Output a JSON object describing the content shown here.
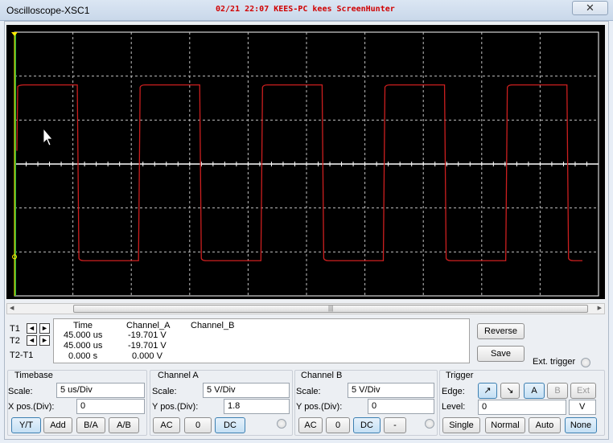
{
  "window": {
    "title": "Oscilloscope-XSC1",
    "banner": "02/21 22:07 KEES-PC kees ScreenHunter",
    "close_glyph": "✕"
  },
  "colors": {
    "screen_bg": "#000000",
    "trace_a": "#cc1f1f",
    "grid": "#bfbfbf",
    "cursor_t1": "#ffeb00",
    "cursor_t2": "#2fb43a"
  },
  "waveform": {
    "type": "square",
    "channel": "A",
    "high_divs": 1.8,
    "low_divs": -2.2,
    "cycles_visible": 4.9
  },
  "cursors": {
    "t1_label": "T1",
    "t2_label": "T2",
    "diff_label": "T2-T1",
    "left_arrow": "◄",
    "right_arrow": "►"
  },
  "readout": {
    "headers": {
      "time": "Time",
      "channel_a": "Channel_A",
      "channel_b": "Channel_B"
    },
    "rows": [
      {
        "time": "45.000 us",
        "channel_a": "-19.701 V",
        "channel_b": ""
      },
      {
        "time": "45.000 us",
        "channel_a": "-19.701 V",
        "channel_b": ""
      },
      {
        "time": "0.000 s",
        "channel_a": "0.000 V",
        "channel_b": ""
      }
    ]
  },
  "actions": {
    "reverse": "Reverse",
    "save": "Save",
    "ext_trigger": "Ext. trigger"
  },
  "timebase": {
    "title": "Timebase",
    "scale_label": "Scale:",
    "scale_value": "5 us/Div",
    "xpos_label": "X pos.(Div):",
    "xpos_value": "0",
    "modes": [
      "Y/T",
      "Add",
      "B/A",
      "A/B"
    ],
    "selected_mode": "Y/T"
  },
  "channel_a": {
    "title": "Channel A",
    "scale_label": "Scale:",
    "scale_value": "5  V/Div",
    "ypos_label": "Y pos.(Div):",
    "ypos_value": "1.8",
    "coupling": [
      "AC",
      "0",
      "DC"
    ],
    "selected_coupling": "DC"
  },
  "channel_b": {
    "title": "Channel B",
    "scale_label": "Scale:",
    "scale_value": "5  V/Div",
    "ypos_label": "Y pos.(Div):",
    "ypos_value": "0",
    "coupling": [
      "AC",
      "0",
      "DC",
      "-"
    ],
    "selected_coupling": "DC"
  },
  "trigger": {
    "title": "Trigger",
    "edge_label": "Edge:",
    "edge_rise": "↗",
    "edge_fall": "↘",
    "sources": [
      "A",
      "B",
      "Ext"
    ],
    "selected_source": "A",
    "level_label": "Level:",
    "level_value": "0",
    "level_unit": "V",
    "modes": [
      "Single",
      "Normal",
      "Auto",
      "None"
    ],
    "selected_mode": "None"
  }
}
